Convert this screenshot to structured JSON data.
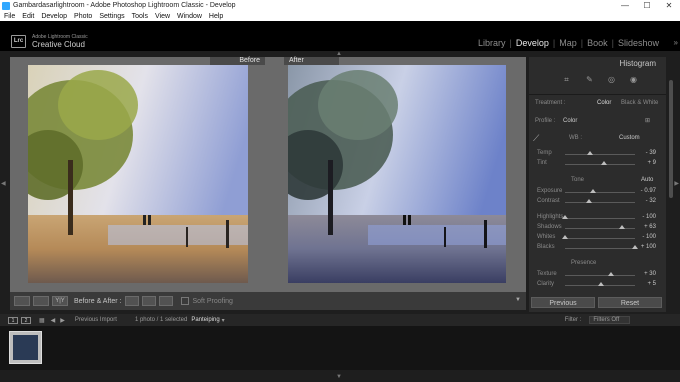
{
  "window": {
    "title": "Gambardasarlightroom - Adobe Photoshop Lightroom Classic - Develop",
    "minimize": "—",
    "maximize": "☐",
    "close": "✕"
  },
  "menu": [
    "File",
    "Edit",
    "Develop",
    "Photo",
    "Settings",
    "Tools",
    "View",
    "Window",
    "Help"
  ],
  "brand": {
    "badge": "Lrc",
    "line1": "Adobe Lightroom Classic",
    "line2": "Creative Cloud"
  },
  "modules": [
    "Library",
    "Develop",
    "Map",
    "Book",
    "Slideshow"
  ],
  "modules_more": "»",
  "compare": {
    "before_label": "Before",
    "after_label": "After"
  },
  "toolbar": {
    "before_after_label": "Before & After :",
    "soft_proofing": "Soft Proofing",
    "yy": "Y|Y"
  },
  "panel": {
    "histogram_title": "Histogram",
    "treatment_label": "Treatment :",
    "treatment_color": "Color",
    "treatment_bw": "Black & White",
    "profile_label": "Profile :",
    "profile_value": "Color",
    "wb_label": "WB :",
    "wb_value": "Custom",
    "tone_label": "Tone",
    "tone_auto": "Auto",
    "presence_label": "Presence",
    "sliders": [
      {
        "name": "Temp",
        "value": "- 39",
        "pos": 0.36
      },
      {
        "name": "Tint",
        "value": "+ 9",
        "pos": 0.55
      },
      {
        "name": "Exposure",
        "value": "- 0.97",
        "pos": 0.4
      },
      {
        "name": "Contrast",
        "value": "- 32",
        "pos": 0.34
      },
      {
        "name": "Highlights",
        "value": "- 100",
        "pos": 0.0
      },
      {
        "name": "Shadows",
        "value": "+ 63",
        "pos": 0.82
      },
      {
        "name": "Whites",
        "value": "- 100",
        "pos": 0.0
      },
      {
        "name": "Blacks",
        "value": "+ 100",
        "pos": 1.0
      },
      {
        "name": "Texture",
        "value": "+ 30",
        "pos": 0.65
      },
      {
        "name": "Clarity",
        "value": "+ 5",
        "pos": 0.52
      }
    ],
    "previous": "Previous",
    "reset": "Reset"
  },
  "filmstrip": {
    "page1": "1",
    "page2": "2",
    "previous_import": "Previous Import",
    "count": "1 photo / 1 selected",
    "filename": "Panteiping",
    "filter_label": "Filter :",
    "filter_value": "Filters Off"
  }
}
